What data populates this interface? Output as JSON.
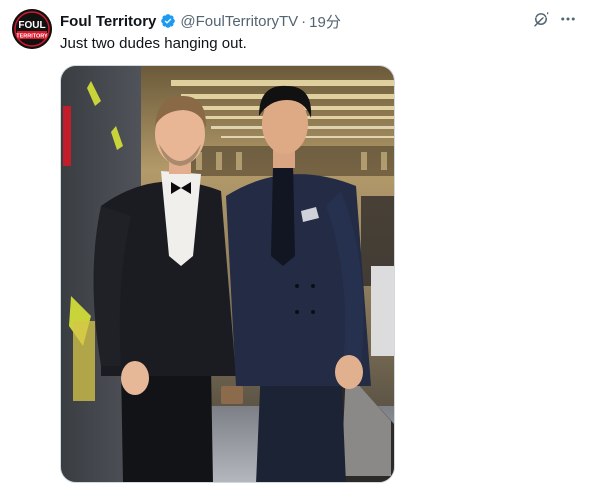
{
  "tweet": {
    "display_name": "Foul Territory",
    "handle": "@FoulTerritoryTV",
    "separator": "·",
    "timestamp": "19分",
    "text": "Just two dudes hanging out.",
    "avatar_logo": {
      "line1": "FOUL",
      "line2": "TERRITORY"
    }
  },
  "icons": {
    "verified": "verified-badge-icon",
    "grok": "grok-icon",
    "more": "more-options-icon"
  },
  "colors": {
    "verified_blue": "#1d9bf0",
    "secondary_text": "#536471",
    "primary_text": "#0f1419",
    "avatar_red": "#d6182a"
  }
}
